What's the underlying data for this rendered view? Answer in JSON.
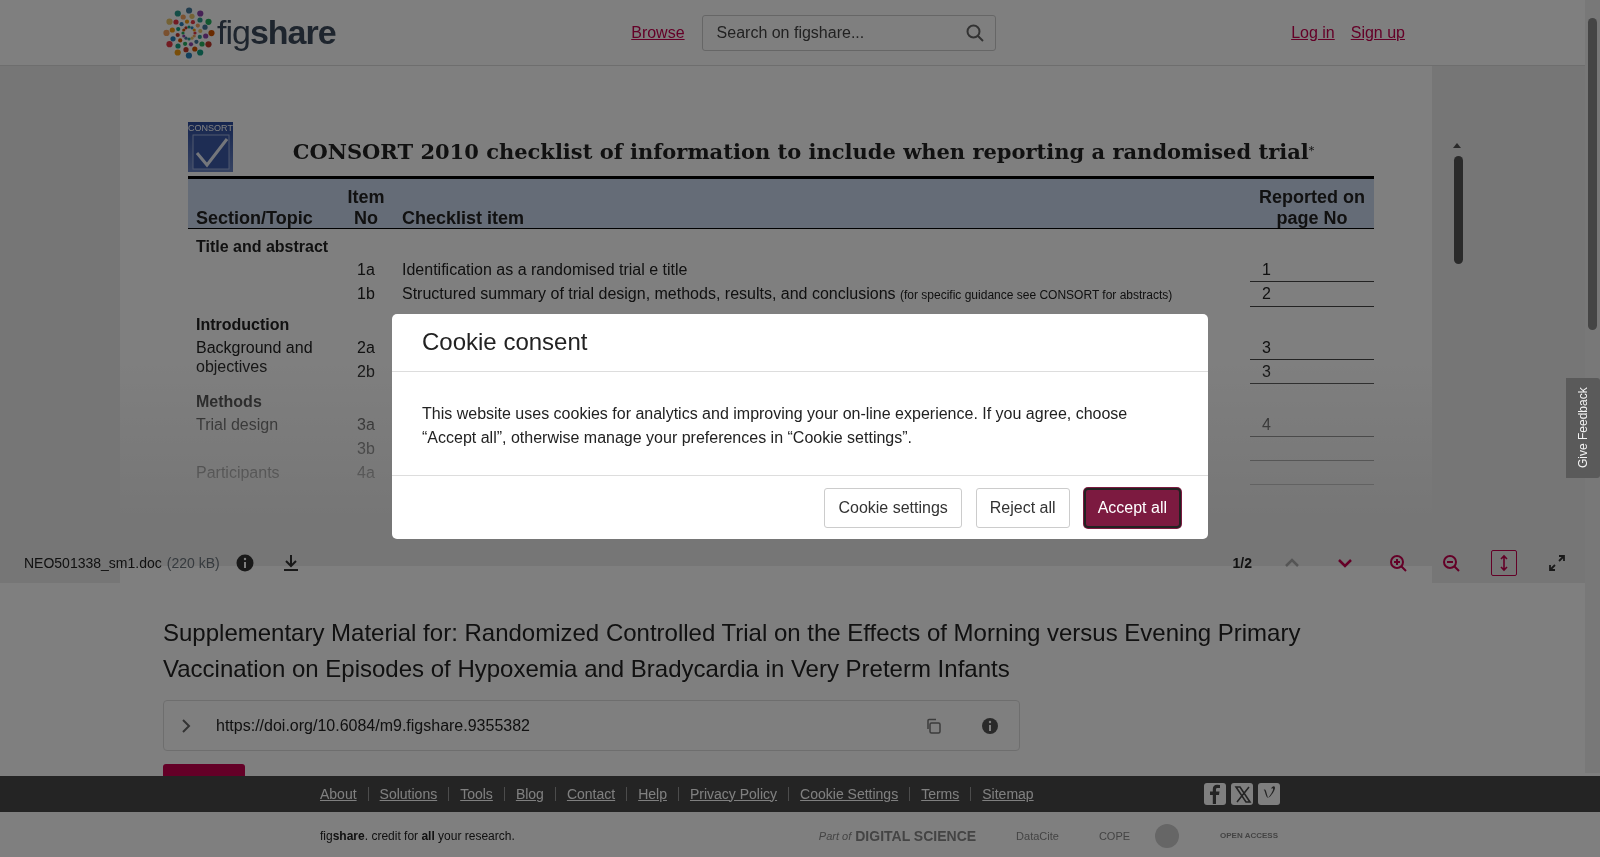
{
  "header": {
    "logo": "fig**share**",
    "nav_link": "Browse",
    "search": {
      "placeholder": "Search on figshare..."
    },
    "auth_links": [
      "Log in",
      "Sign up"
    ]
  },
  "viewer": {
    "document": {
      "logo_text": "CONSORT",
      "title": "CONSORT 2010 checklist of information to include when reporting a randomised trial$^{*}$",
      "columns": [
        "Section/Topic",
        "Item No",
        "Checklist item",
        "Reported on page No"
      ],
      "sections": [
        {
          "title": "Title and abstract",
          "groups": [
            {
              "items": [
                {
                  "no": "1a",
                  "text": "Identification as a randomised trial e title",
                  "page": "1"
                },
                {
                  "no": "1b",
                  "text": "Structured summary of trial design, methods, results, and conclusions",
                  "note": "(for specific guidance see CONSORT for abstracts)",
                  "page": "2"
                }
              ]
            }
          ]
        },
        {
          "title": "Introduction",
          "groups": [
            {
              "topic": "Background and objectives",
              "items": [
                {
                  "no": "2a",
                  "page": "3"
                },
                {
                  "no": "2b",
                  "page": "3"
                }
              ]
            }
          ]
        },
        {
          "title": "Methods",
          "groups": [
            {
              "topic": "Trial design",
              "items": [
                {
                  "no": "3a",
                  "page": "4"
                },
                {
                  "no": "3b"
                }
              ]
            },
            {
              "topic": "Participants",
              "items": [
                {
                  "no": "4a"
                }
              ]
            }
          ]
        }
      ]
    },
    "toolbar": {
      "file_name": "NEO501338_sm1.doc",
      "file_size": "(220 kB)",
      "page": "1/2",
      "controls": [
        {
          "kind": "prev",
          "disabled": true,
          "active": false
        },
        {
          "kind": "next",
          "disabled": false,
          "active": false
        },
        {
          "kind": "zoom_in",
          "disabled": false,
          "active": false
        },
        {
          "kind": "zoom_out",
          "disabled": false,
          "active": false
        },
        {
          "kind": "fit",
          "disabled": false,
          "active": true
        },
        {
          "kind": "fullscreen",
          "disabled": false,
          "active": false
        }
      ]
    }
  },
  "feedback_tab": "Give Feedback",
  "item": {
    "title": "Supplementary Material for: Randomized Controlled Trial on the Effects of Morning versus Evening Primary Vaccination on Episodes of Hypoxemia and Bradycardia in Very Preterm Infants",
    "doi": "https://doi.org/10.6084/m9.figshare.9355382"
  },
  "cookie_dialog": {
    "title": "Cookie consent",
    "body": "This website uses cookies for analytics and improving your on-line experience. If you agree, choose “Accept all”, otherwise manage your preferences in “Cookie settings”.",
    "buttons": [
      {
        "label": "Cookie settings",
        "kind": "secondary"
      },
      {
        "label": "Reject all",
        "kind": "secondary"
      },
      {
        "label": "Accept all",
        "kind": "primary"
      }
    ]
  },
  "footer": {
    "links": [
      "About",
      "Solutions",
      "Tools",
      "Blog",
      "Contact",
      "Help",
      "Privacy Policy",
      "Cookie Settings",
      "Terms",
      "Sitemap"
    ],
    "tagline": "fig**share**. credit for **all** your research.",
    "partners": [
      "Part of",
      "DIGITAL SCIENCE",
      "DataCite",
      "COPE",
      "OPEN ACCESS"
    ]
  }
}
